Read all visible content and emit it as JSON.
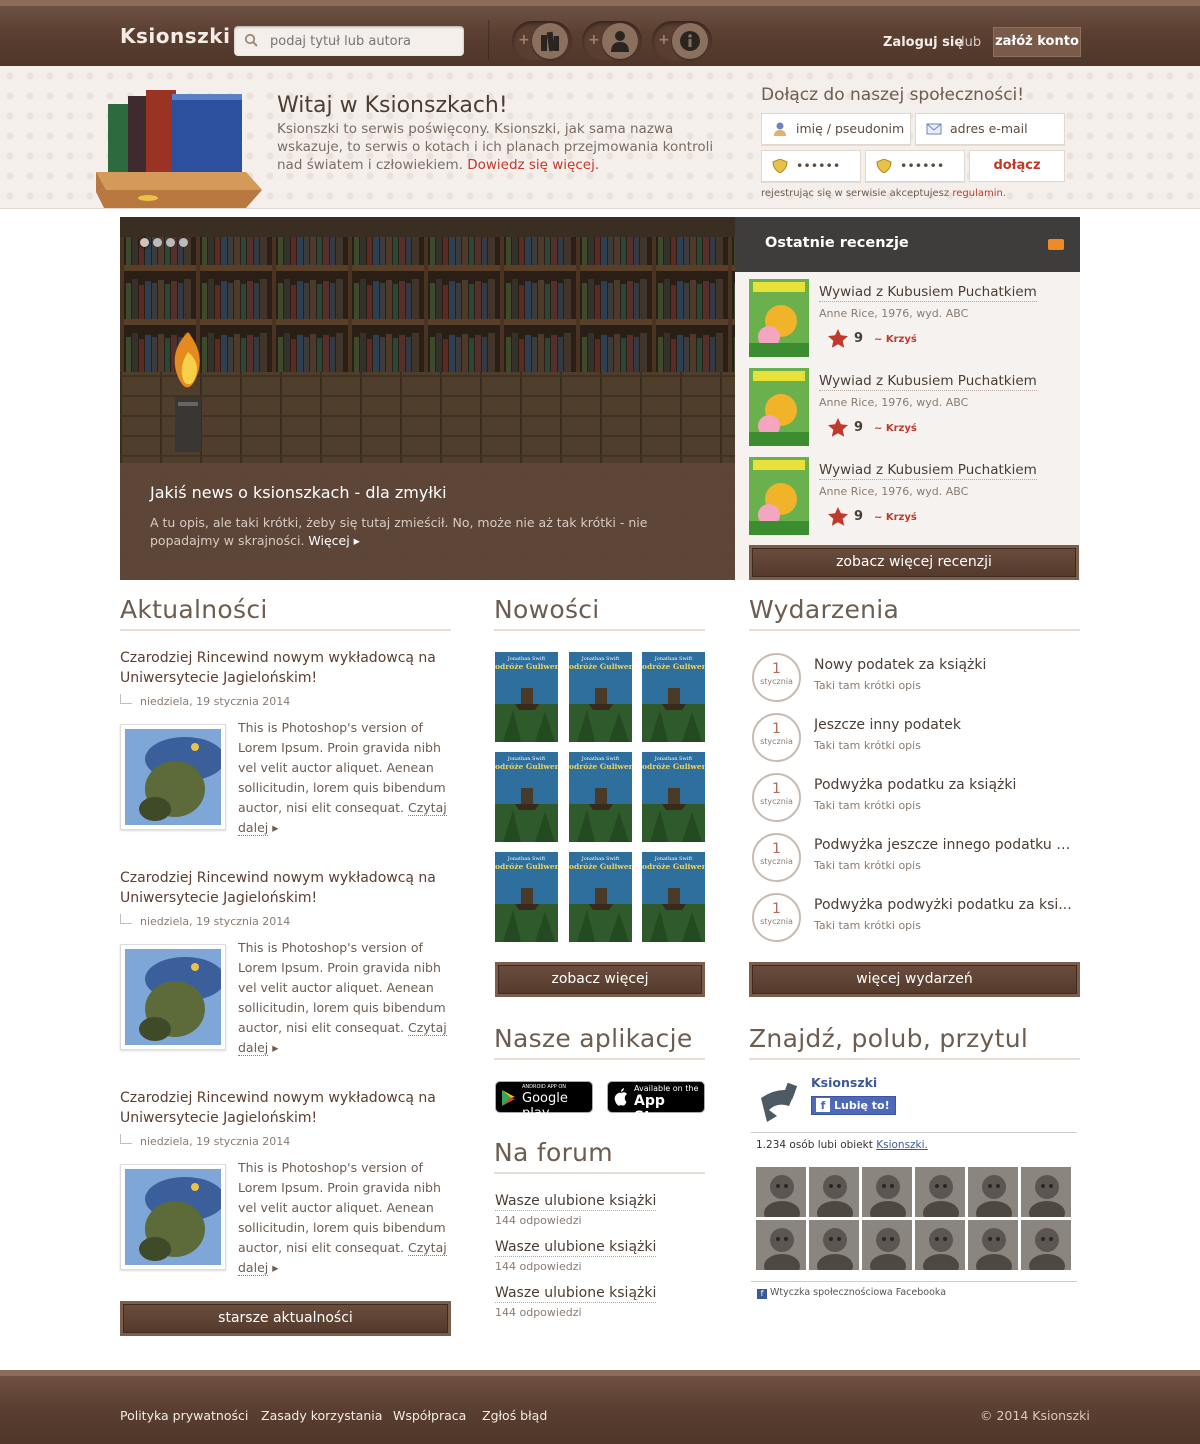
{
  "header": {
    "logo": "Ksionszki",
    "search_placeholder": "podaj tytuł lub autora",
    "nav_icons": [
      "books-icon",
      "user-icon",
      "info-icon"
    ],
    "login": "Zaloguj się",
    "or": "lub",
    "register": "załóż konto"
  },
  "hero": {
    "title": "Witaj w Ksionszkach!",
    "text": "Ksionszki to serwis poświęcony. Ksionszki, jak sama nazwa wskazuje, to serwis o kotach i ich planach przejmowania kontroli nad światem i człowiekiem.",
    "link": "Dowiedz się więcej.",
    "join_title": "Dołącz do naszej społeczności!",
    "name_placeholder": "imię / pseudonim",
    "email_placeholder": "adres e-mail",
    "password1": "••••••",
    "password2": "••••••",
    "join_button": "dołącz",
    "terms_prefix": "rejestrując się w serwisie akceptujesz",
    "terms_link": "regulamin",
    "terms_suffix": "."
  },
  "slider": {
    "title": "Jakiś news o ksionszkach - dla zmyłki",
    "text": "A tu opis, ale taki krótki, żeby się tutaj zmieścił. No, może nie aż tak krótki - nie popadajmy w skrajności.",
    "more": "Więcej ▸",
    "active_dot": 1,
    "dot_count": 4
  },
  "reviews": {
    "heading": "Ostatnie recenzje",
    "items": [
      {
        "title": "Wywiad z Kubusiem Puchatkiem",
        "meta": "Anne Rice, 1976, wyd. ABC",
        "score": "9",
        "author": "~ Krzyś"
      },
      {
        "title": "Wywiad z Kubusiem Puchatkiem",
        "meta": "Anne Rice, 1976, wyd. ABC",
        "score": "9",
        "author": "~ Krzyś"
      },
      {
        "title": "Wywiad z Kubusiem Puchatkiem",
        "meta": "Anne Rice, 1976, wyd. ABC",
        "score": "9",
        "author": "~ Krzyś"
      }
    ],
    "more_button": "zobacz więcej recenzji"
  },
  "news": {
    "heading": "Aktualności",
    "items": [
      {
        "title": "Czarodziej Rincewind nowym wykładowcą na Uniwersytecie Jagielońskim!",
        "date": "niedziela, 19 stycznia 2014",
        "text": "This is Photoshop's version  of Lorem Ipsum. Proin gravida nibh vel velit auctor aliquet. Aenean sollicitudin, lorem quis bibendum auctor, nisi elit consequat.",
        "more": "Czytaj dalej"
      },
      {
        "title": "Czarodziej Rincewind nowym wykładowcą na Uniwersytecie Jagielońskim!",
        "date": "niedziela, 19 stycznia 2014",
        "text": "This is Photoshop's version  of Lorem Ipsum. Proin gravida nibh vel velit auctor aliquet. Aenean sollicitudin, lorem quis bibendum auctor, nisi elit consequat.",
        "more": "Czytaj dalej"
      },
      {
        "title": "Czarodziej Rincewind nowym wykładowcą na Uniwersytecie Jagielońskim!",
        "date": "niedziela, 19 stycznia 2014",
        "text": "This is Photoshop's version  of Lorem Ipsum. Proin gravida nibh vel velit auctor aliquet. Aenean sollicitudin, lorem quis bibendum auctor, nisi elit consequat.",
        "more": "Czytaj dalej"
      }
    ],
    "more_button": "starsze aktualności"
  },
  "new_books": {
    "heading": "Nowości",
    "book_author": "Jonathan Swift",
    "book_title": "Podróże Guliwera",
    "count": 9,
    "more_button": "zobacz więcej"
  },
  "apps": {
    "heading": "Nasze aplikacje",
    "google_small": "ANDROID APP ON",
    "google_big": "Google play",
    "apple_small": "Available on the",
    "apple_big": "App Store"
  },
  "forum": {
    "heading": "Na forum",
    "items": [
      {
        "title": "Wasze ulubione książki",
        "count": "144 odpowiedzi"
      },
      {
        "title": "Wasze ulubione książki",
        "count": "144 odpowiedzi"
      },
      {
        "title": "Wasze ulubione książki",
        "count": "144 odpowiedzi"
      }
    ]
  },
  "events": {
    "heading": "Wydarzenia",
    "items": [
      {
        "day": "1",
        "month": "stycznia",
        "title": "Nowy podatek za książki",
        "desc": "Taki tam krótki opis"
      },
      {
        "day": "1",
        "month": "stycznia",
        "title": "Jeszcze inny podatek",
        "desc": "Taki tam krótki opis"
      },
      {
        "day": "1",
        "month": "stycznia",
        "title": "Podwyżka podatku za książki",
        "desc": "Taki tam krótki opis"
      },
      {
        "day": "1",
        "month": "stycznia",
        "title": "Podwyżka jeszcze innego podatku z...",
        "desc": "Taki tam krótki opis"
      },
      {
        "day": "1",
        "month": "stycznia",
        "title": "Podwyżka podwyżki podatku za ksi...",
        "desc": "Taki tam krótki opis"
      }
    ],
    "more_button": "więcej wydarzeń"
  },
  "social": {
    "heading": "Znajdź, polub, przytul",
    "page_name": "Ksionszki",
    "like": "Lubię to!",
    "count_prefix": "1.234 osób lubi obiekt",
    "count_link": "Ksionszki.",
    "plugin": "Wtyczka społecznościowa Facebooka"
  },
  "footer": {
    "links": [
      "Polityka prywatności",
      "Zasady korzystania",
      "Współpraca",
      "Zgłoś błąd"
    ],
    "copyright": "© 2014 Ksionszki"
  },
  "colors": {
    "wood": "#5b4032",
    "accent_red": "#c0392b",
    "text": "#4a3d34",
    "rss": "#f08a24",
    "facebook": "#3b5998"
  }
}
